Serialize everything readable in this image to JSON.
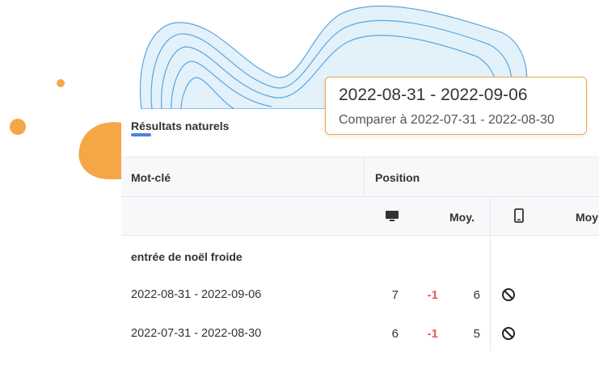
{
  "section": {
    "title": "Résultats naturels"
  },
  "table": {
    "col_keyword": "Mot-clé",
    "col_position": "Position",
    "sub_avg_desktop": "Moy.",
    "sub_avg_mobile": "Moy",
    "keyword": "entrée de noël froide",
    "rows": [
      {
        "period": "2022-08-31 - 2022-09-06",
        "desktop": "7",
        "change": "-1",
        "avg": "6"
      },
      {
        "period": "2022-07-31 - 2022-08-30",
        "desktop": "6",
        "change": "-1",
        "avg": "5"
      }
    ]
  },
  "tooltip": {
    "period": "2022-08-31 - 2022-09-06",
    "compare": "Comparer à 2022-07-31 - 2022-08-30"
  },
  "icons": {
    "desktop": "desktop-icon",
    "mobile": "mobile-icon",
    "unavailable": "no-entry-icon"
  },
  "colors": {
    "accent_orange": "#f2a540",
    "accent_blue": "#4a82e0",
    "negative": "#e05d5d"
  }
}
